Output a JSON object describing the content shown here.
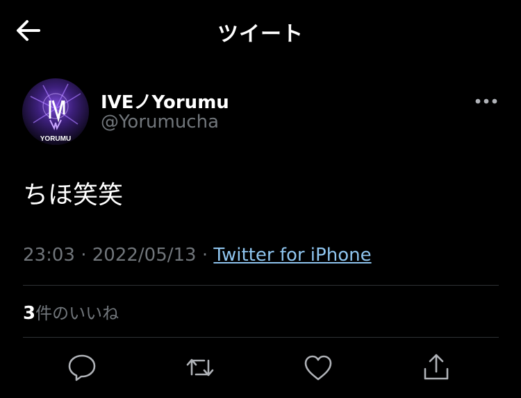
{
  "header": {
    "title": "ツイート",
    "back_icon": "arrow-left-icon"
  },
  "tweet": {
    "author": {
      "display_name": "IVEノYorumu",
      "handle": "@Yorumucha",
      "avatar_text": "YORUMU"
    },
    "text": "ちほ笑笑",
    "time": "23:03",
    "separator": " · ",
    "date": "2022/05/13",
    "source": "Twitter for iPhone"
  },
  "engagement": {
    "like_count": "3",
    "like_label": "件のいいね"
  },
  "actions": [
    {
      "icon": "reply-icon"
    },
    {
      "icon": "retweet-icon"
    },
    {
      "icon": "like-icon"
    },
    {
      "icon": "share-icon"
    }
  ],
  "colors": {
    "background": "#000000",
    "text_primary": "#ffffff",
    "text_secondary": "#71767b",
    "link": "#8fc5ef",
    "divider": "#2f3336",
    "icon": "#b0b3b8"
  }
}
